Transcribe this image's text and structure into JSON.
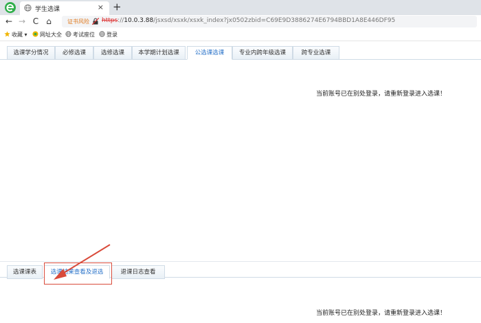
{
  "browser": {
    "tab_title": "学生选课",
    "tab_close": "×",
    "new_tab": "+",
    "nav_back": "←",
    "nav_forward": "→",
    "nav_reload": "C",
    "nav_home": "⌂",
    "cert_warning": "证书风险",
    "url_scheme": "https",
    "url_host": "10.0.3.88",
    "url_path": "/jsxsd/xsxk/xsxk_index?jx0502zbid=C69E9D3886274E6794BBD1A8E446DF95",
    "url_sep": "://"
  },
  "bookmarks": [
    {
      "label": "收藏",
      "icon": "star-icon"
    },
    {
      "label": "网址大全",
      "icon": "site-directory-icon"
    },
    {
      "label": "考试座位",
      "icon": "globe-icon"
    },
    {
      "label": "登录",
      "icon": "globe-icon"
    }
  ],
  "top_tabs": [
    {
      "label": "选课学分情况"
    },
    {
      "label": "必修选课"
    },
    {
      "label": "选修选课"
    },
    {
      "label": "本学期计划选课"
    },
    {
      "label": "公选课选课",
      "active": true
    },
    {
      "label": "专业内跨年级选课"
    },
    {
      "label": "跨专业选课"
    }
  ],
  "top_message": "当前账号已在别处登录，请重新登录进入选课！",
  "bottom_tabs": [
    {
      "label": "选课课表"
    },
    {
      "label": "选课结果查看及退选",
      "active": true
    },
    {
      "label": "退课日志查看"
    }
  ],
  "bottom_message": "当前账号已在别处登录，请重新登录进入选课！",
  "colors": {
    "accent": "#2a73c9",
    "annotation": "#d94a3a",
    "warning": "#e07a1f"
  }
}
